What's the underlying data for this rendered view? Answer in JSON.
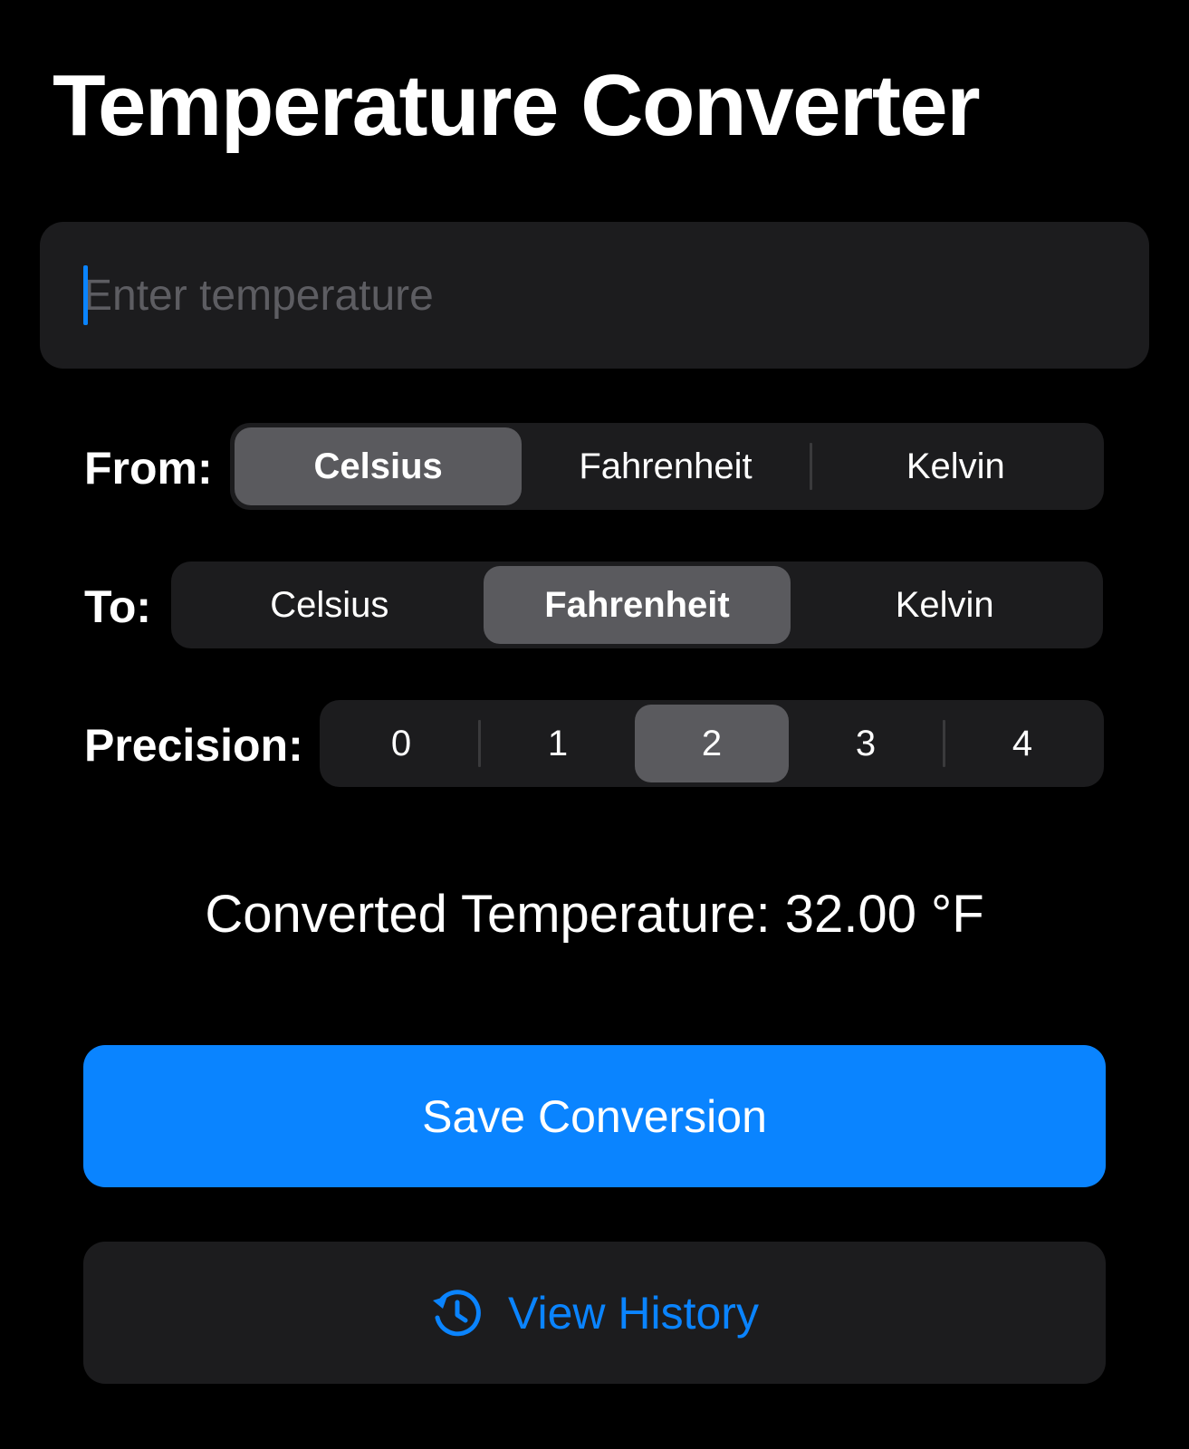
{
  "title": "Temperature Converter",
  "input": {
    "placeholder": "Enter temperature",
    "value": ""
  },
  "from": {
    "label": "From:",
    "options": [
      "Celsius",
      "Fahrenheit",
      "Kelvin"
    ],
    "selected": "Celsius"
  },
  "to": {
    "label": "To:",
    "options": [
      "Celsius",
      "Fahrenheit",
      "Kelvin"
    ],
    "selected": "Fahrenheit"
  },
  "precision": {
    "label": "Precision:",
    "options": [
      "0",
      "1",
      "2",
      "3",
      "4"
    ],
    "selected": "2"
  },
  "result": {
    "text": "Converted Temperature: 32.00 °F"
  },
  "buttons": {
    "save_label": "Save Conversion",
    "history_label": "View History",
    "history_icon": "clock-history-icon"
  },
  "colors": {
    "background": "#000000",
    "surface": "#1c1c1e",
    "selected_segment": "#5a5a5e",
    "accent": "#0a84ff",
    "placeholder": "#5d5d62"
  }
}
